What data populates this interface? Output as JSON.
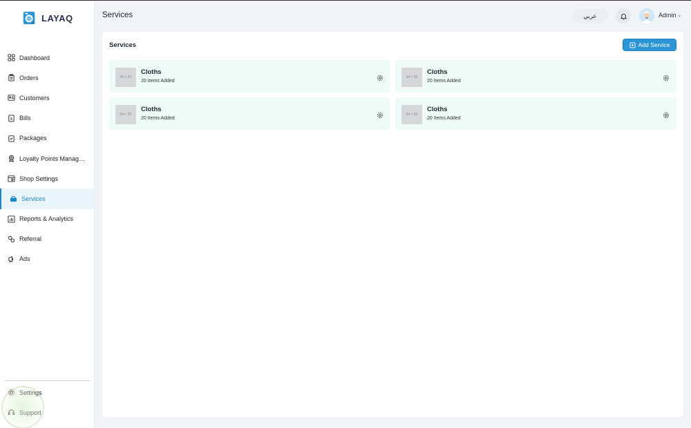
{
  "app": {
    "name": "LAYAQ"
  },
  "header": {
    "title": "Services",
    "language_label": "عربي",
    "user_name": "Admin"
  },
  "sidebar": {
    "items": [
      {
        "label": "Dashboard",
        "icon": "dashboard-icon"
      },
      {
        "label": "Orders",
        "icon": "clipboard-icon"
      },
      {
        "label": "Customers",
        "icon": "id-card-icon"
      },
      {
        "label": "Bills",
        "icon": "dollar-receipt-icon"
      },
      {
        "label": "Packages",
        "icon": "package-icon"
      },
      {
        "label": "Loyalty Points Manage...",
        "icon": "award-icon"
      },
      {
        "label": "Shop Settings",
        "icon": "shop-settings-icon"
      },
      {
        "label": "Services",
        "icon": "basket-icon",
        "active": true
      },
      {
        "label": "Reports & Analytics",
        "icon": "chart-icon"
      },
      {
        "label": "Referral",
        "icon": "link-icon"
      },
      {
        "label": "Ads",
        "icon": "megaphone-icon"
      }
    ],
    "bottom_items": [
      {
        "label": "Settings",
        "icon": "gear-icon"
      },
      {
        "label": "Support",
        "icon": "headset-icon"
      }
    ]
  },
  "main": {
    "section_title": "Services",
    "add_button_label": "Add Service",
    "services": [
      {
        "name": "Cloths",
        "count_text": "20 Items Added",
        "thumb_text": "54 × 52"
      },
      {
        "name": "Cloths",
        "count_text": "20 Items Added",
        "thumb_text": "54 × 52"
      },
      {
        "name": "Cloths",
        "count_text": "20 Items Added",
        "thumb_text": "54 × 52"
      },
      {
        "name": "Cloths",
        "count_text": "20 Items Added",
        "thumb_text": "54 × 52"
      }
    ]
  },
  "colors": {
    "accent": "#1a86c9",
    "button": "#2b95d6",
    "card_bg": "#effbf7",
    "page_bg": "#f1f3f6"
  }
}
